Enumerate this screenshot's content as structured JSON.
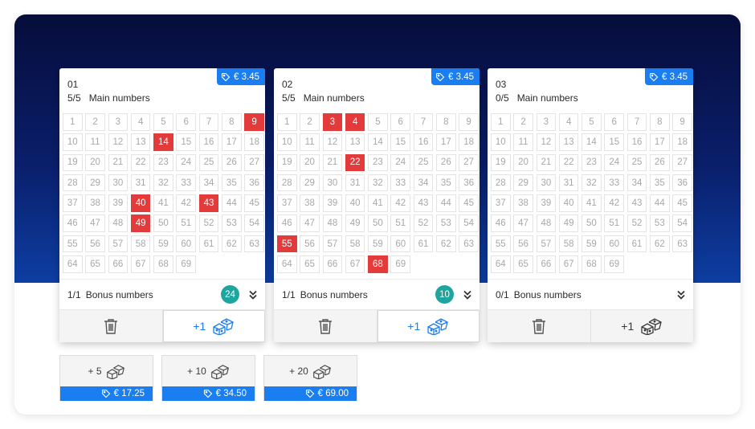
{
  "tickets": [
    {
      "number": "01",
      "price": "€ 3.45",
      "main_count": "5/5",
      "main_label": "Main numbers",
      "numbers": [
        "1",
        "2",
        "3",
        "4",
        "5",
        "6",
        "7",
        "8",
        "9",
        "10",
        "11",
        "12",
        "13",
        "14",
        "15",
        "16",
        "17",
        "18",
        "19",
        "20",
        "21",
        "22",
        "23",
        "24",
        "25",
        "26",
        "27",
        "28",
        "29",
        "30",
        "31",
        "32",
        "33",
        "34",
        "35",
        "36",
        "37",
        "38",
        "39",
        "40",
        "41",
        "42",
        "43",
        "44",
        "45",
        "46",
        "47",
        "48",
        "49",
        "50",
        "51",
        "52",
        "53",
        "54",
        "55",
        "56",
        "57",
        "58",
        "59",
        "60",
        "61",
        "62",
        "63",
        "64",
        "65",
        "66",
        "67",
        "68",
        "69"
      ],
      "selected": [
        "9",
        "14",
        "40",
        "43",
        "49"
      ],
      "bonus_count": "1/1",
      "bonus_label": "Bonus numbers",
      "bonus_value": "24",
      "add_label": "+1"
    },
    {
      "number": "02",
      "price": "€ 3.45",
      "main_count": "5/5",
      "main_label": "Main numbers",
      "numbers": [
        "1",
        "2",
        "3",
        "4",
        "5",
        "6",
        "7",
        "8",
        "9",
        "10",
        "11",
        "12",
        "13",
        "14",
        "15",
        "16",
        "17",
        "18",
        "19",
        "20",
        "21",
        "22",
        "23",
        "24",
        "25",
        "26",
        "27",
        "28",
        "29",
        "30",
        "31",
        "32",
        "33",
        "34",
        "35",
        "36",
        "37",
        "38",
        "39",
        "40",
        "41",
        "42",
        "43",
        "44",
        "45",
        "46",
        "47",
        "48",
        "49",
        "50",
        "51",
        "52",
        "53",
        "54",
        "55",
        "56",
        "57",
        "58",
        "59",
        "60",
        "61",
        "62",
        "63",
        "64",
        "65",
        "66",
        "67",
        "68",
        "69"
      ],
      "selected": [
        "3",
        "4",
        "22",
        "55",
        "68"
      ],
      "bonus_count": "1/1",
      "bonus_label": "Bonus numbers",
      "bonus_value": "10",
      "add_label": "+1"
    },
    {
      "number": "03",
      "price": "€ 3.45",
      "main_count": "0/5",
      "main_label": "Main numbers",
      "numbers": [
        "1",
        "2",
        "3",
        "4",
        "5",
        "6",
        "7",
        "8",
        "9",
        "10",
        "11",
        "12",
        "13",
        "14",
        "15",
        "16",
        "17",
        "18",
        "19",
        "20",
        "21",
        "22",
        "23",
        "24",
        "25",
        "26",
        "27",
        "28",
        "29",
        "30",
        "31",
        "32",
        "33",
        "34",
        "35",
        "36",
        "37",
        "38",
        "39",
        "40",
        "41",
        "42",
        "43",
        "44",
        "45",
        "46",
        "47",
        "48",
        "49",
        "50",
        "51",
        "52",
        "53",
        "54",
        "55",
        "56",
        "57",
        "58",
        "59",
        "60",
        "61",
        "62",
        "63",
        "64",
        "65",
        "66",
        "67",
        "68",
        "69"
      ],
      "selected": [],
      "bonus_count": "0/1",
      "bonus_label": "Bonus numbers",
      "bonus_value": null,
      "add_label": "+1"
    }
  ],
  "quick_picks": [
    {
      "label": "+ 5",
      "price": "€ 17.25"
    },
    {
      "label": "+ 10",
      "price": "€ 34.50"
    },
    {
      "label": "+ 20",
      "price": "€ 69.00"
    }
  ],
  "colors": {
    "accent_blue": "#1a7df0",
    "selected_red": "#e33b3b",
    "bonus_teal": "#1fa59f",
    "hero_dark": "#060d3a"
  },
  "icons": {
    "price": "tag-icon",
    "delete": "trash-icon",
    "quick_pick": "dice-icon",
    "expand": "double-chevron-down-icon"
  }
}
